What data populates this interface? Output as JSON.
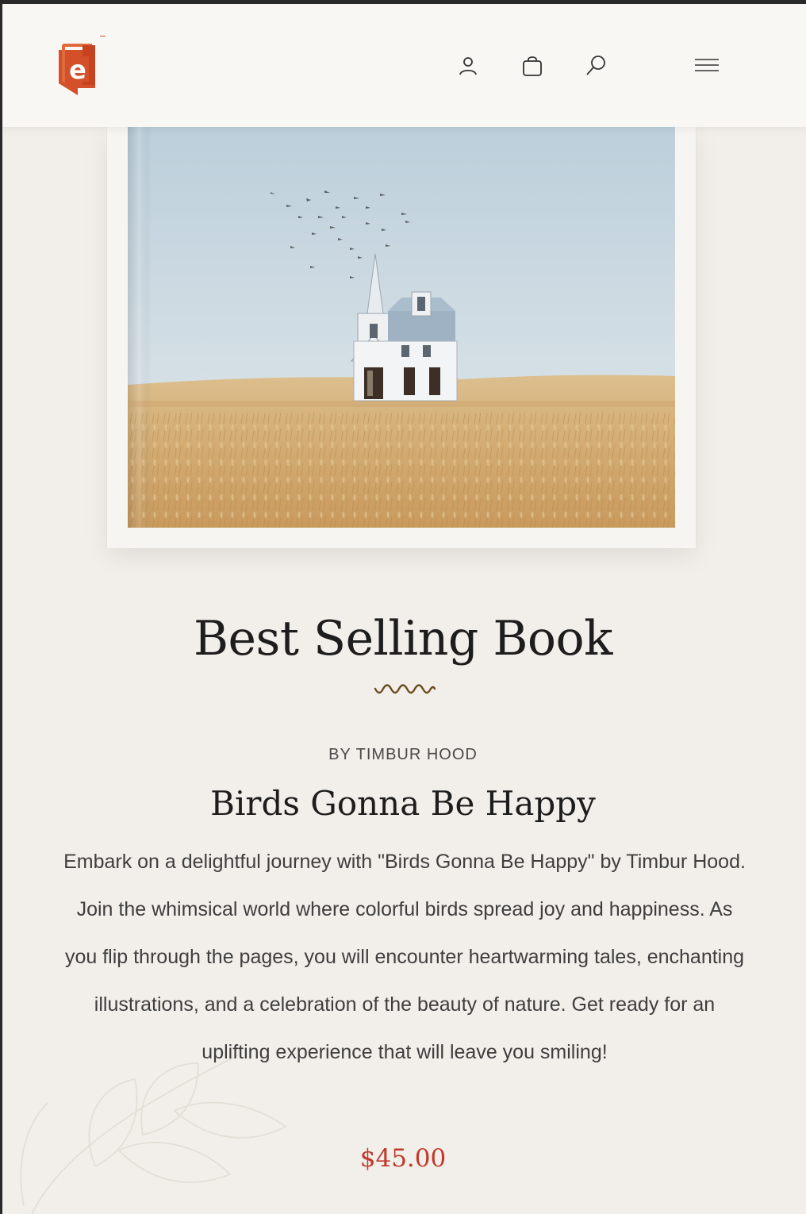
{
  "colors": {
    "accent": "#d4502a",
    "price": "#c0392b",
    "background": "#f2efea",
    "header_bg": "#f8f7f4",
    "title": "#1d1d1d",
    "squiggle": "#6b4a1e"
  },
  "header": {
    "logo_icon": "book-e-logo",
    "icons": [
      "user-icon",
      "shopping-bag-icon",
      "search-icon",
      "hamburger-menu-icon"
    ]
  },
  "hero": {
    "image_icon": "book-cover-house-wheatfield-image"
  },
  "section": {
    "title": "Best Selling Book",
    "divider_icon": "squiggle-divider-icon"
  },
  "book": {
    "author": "BY TIMBUR HOOD",
    "title": "Birds Gonna Be Happy",
    "description": "Embark on a delightful journey with \"Birds Gonna Be Happy\" by Timbur Hood. Join the whimsical world where colorful birds spread joy and happiness. As you flip through the pages, you will encounter heartwarming tales, enchanting illustrations, and a celebration of the beauty of nature. Get ready for an uplifting experience that will leave you smiling!",
    "price": "$45.00"
  }
}
